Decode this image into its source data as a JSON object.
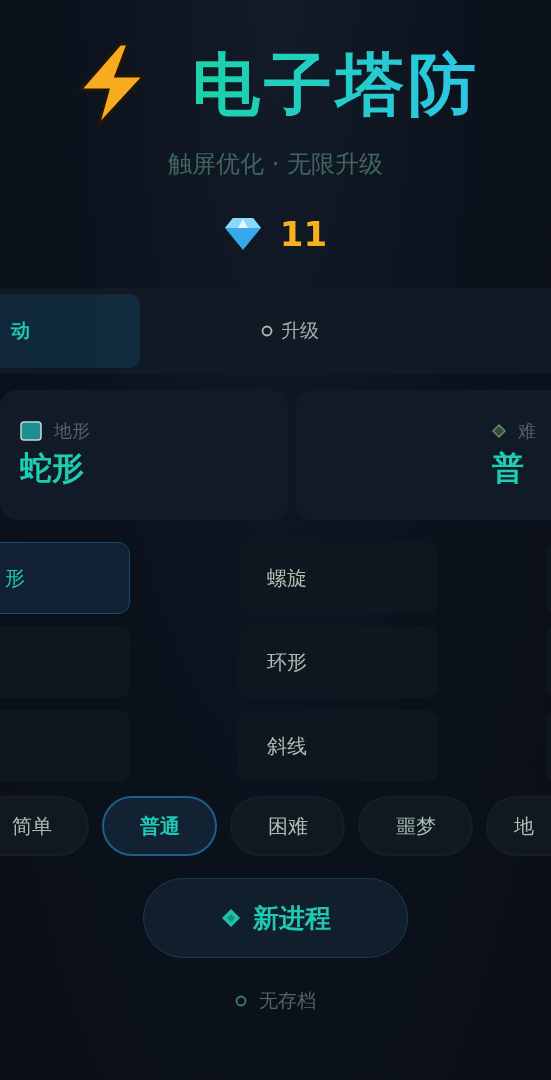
{
  "header": {
    "title": "电子塔防",
    "subtitle": "触屏优化 · 无限升级",
    "gems": "11"
  },
  "tabs": [
    {
      "label": "动",
      "selected": true
    },
    {
      "label": "升级",
      "selected": false
    }
  ],
  "summary": [
    {
      "label": "地形",
      "value": "蛇形"
    },
    {
      "label": "难",
      "value": "普"
    }
  ],
  "terrains": [
    {
      "label": "形",
      "selected": true
    },
    {
      "label": "螺旋",
      "selected": false
    },
    {
      "selected": false
    },
    {
      "label": "环形",
      "selected": false
    },
    {
      "selected": false
    },
    {
      "label": "斜线",
      "selected": false
    }
  ],
  "difficulties": [
    {
      "label": "简单",
      "selected": false
    },
    {
      "label": "普通",
      "selected": true
    },
    {
      "label": "困难",
      "selected": false
    },
    {
      "label": "噩梦",
      "selected": false
    },
    {
      "label": "地",
      "selected": false
    }
  ],
  "start_button": "新进程",
  "save_status": "无存档"
}
